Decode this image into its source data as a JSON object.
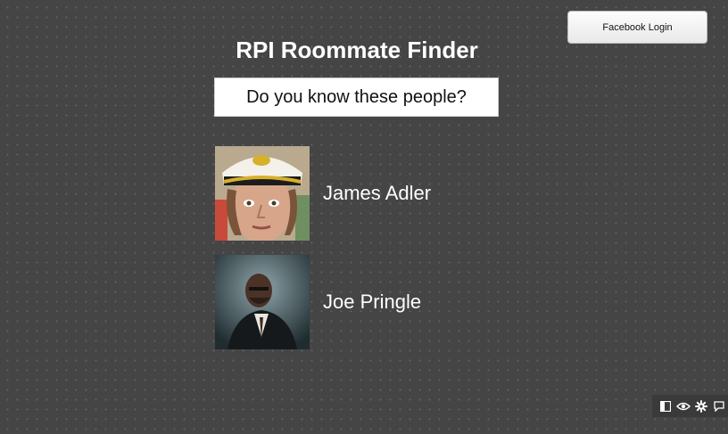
{
  "header": {
    "login_label": "Facebook Login"
  },
  "main": {
    "title": "RPI Roommate Finder",
    "prompt": "Do you know these people?",
    "people": [
      {
        "name": "James Adler"
      },
      {
        "name": "Joe Pringle"
      }
    ]
  },
  "toolbar": {
    "icons": [
      "sidebar-toggle-icon",
      "eye-icon",
      "gear-icon",
      "comment-icon"
    ]
  },
  "colors": {
    "background": "#454545",
    "prompt_background": "#ffffff",
    "button_background": "#f4f4f4",
    "text": "#ffffff"
  }
}
